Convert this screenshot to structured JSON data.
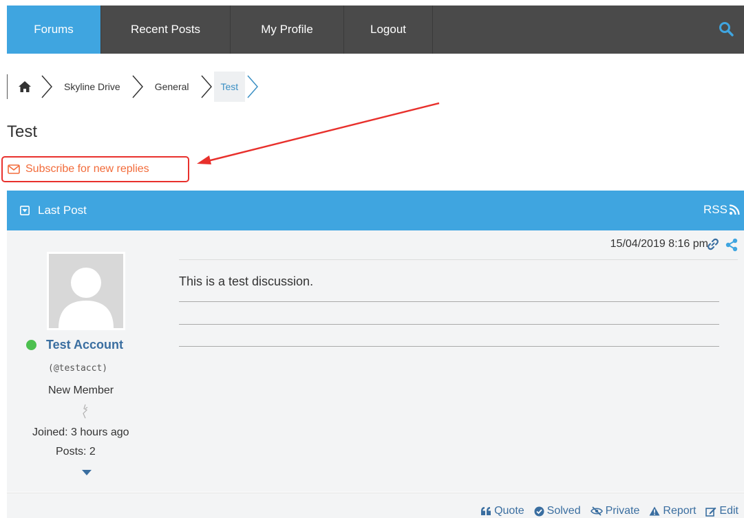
{
  "nav": {
    "items": [
      {
        "label": "Forums",
        "active": true
      },
      {
        "label": "Recent Posts",
        "active": false
      },
      {
        "label": "My Profile",
        "active": false
      },
      {
        "label": "Logout",
        "active": false
      }
    ],
    "search_icon": "search-icon"
  },
  "breadcrumb": {
    "home_icon": "home-icon",
    "items": [
      "Skyline Drive",
      "General",
      "Test"
    ]
  },
  "page": {
    "title": "Test",
    "subscribe_label": "Subscribe for new replies"
  },
  "post": {
    "header_title": "Last Post",
    "rss_label": "RSS",
    "date": "15/04/2019 8:16 pm",
    "content": "This is a test discussion.",
    "author": {
      "name": "Test Account",
      "handle": "(@testacct)",
      "rank": "New Member",
      "joined": "Joined: 3 hours ago",
      "posts": "Posts: 2",
      "online": true
    },
    "actions": [
      "Quote",
      "Solved",
      "Private",
      "Report",
      "Edit"
    ]
  },
  "colors": {
    "nav_bg": "#4a4a4a",
    "accent": "#3fa5e0",
    "subscribe": "#f26b3a",
    "annotation": "#e8302c",
    "online": "#4cc04f",
    "link": "#3a6ea0"
  }
}
